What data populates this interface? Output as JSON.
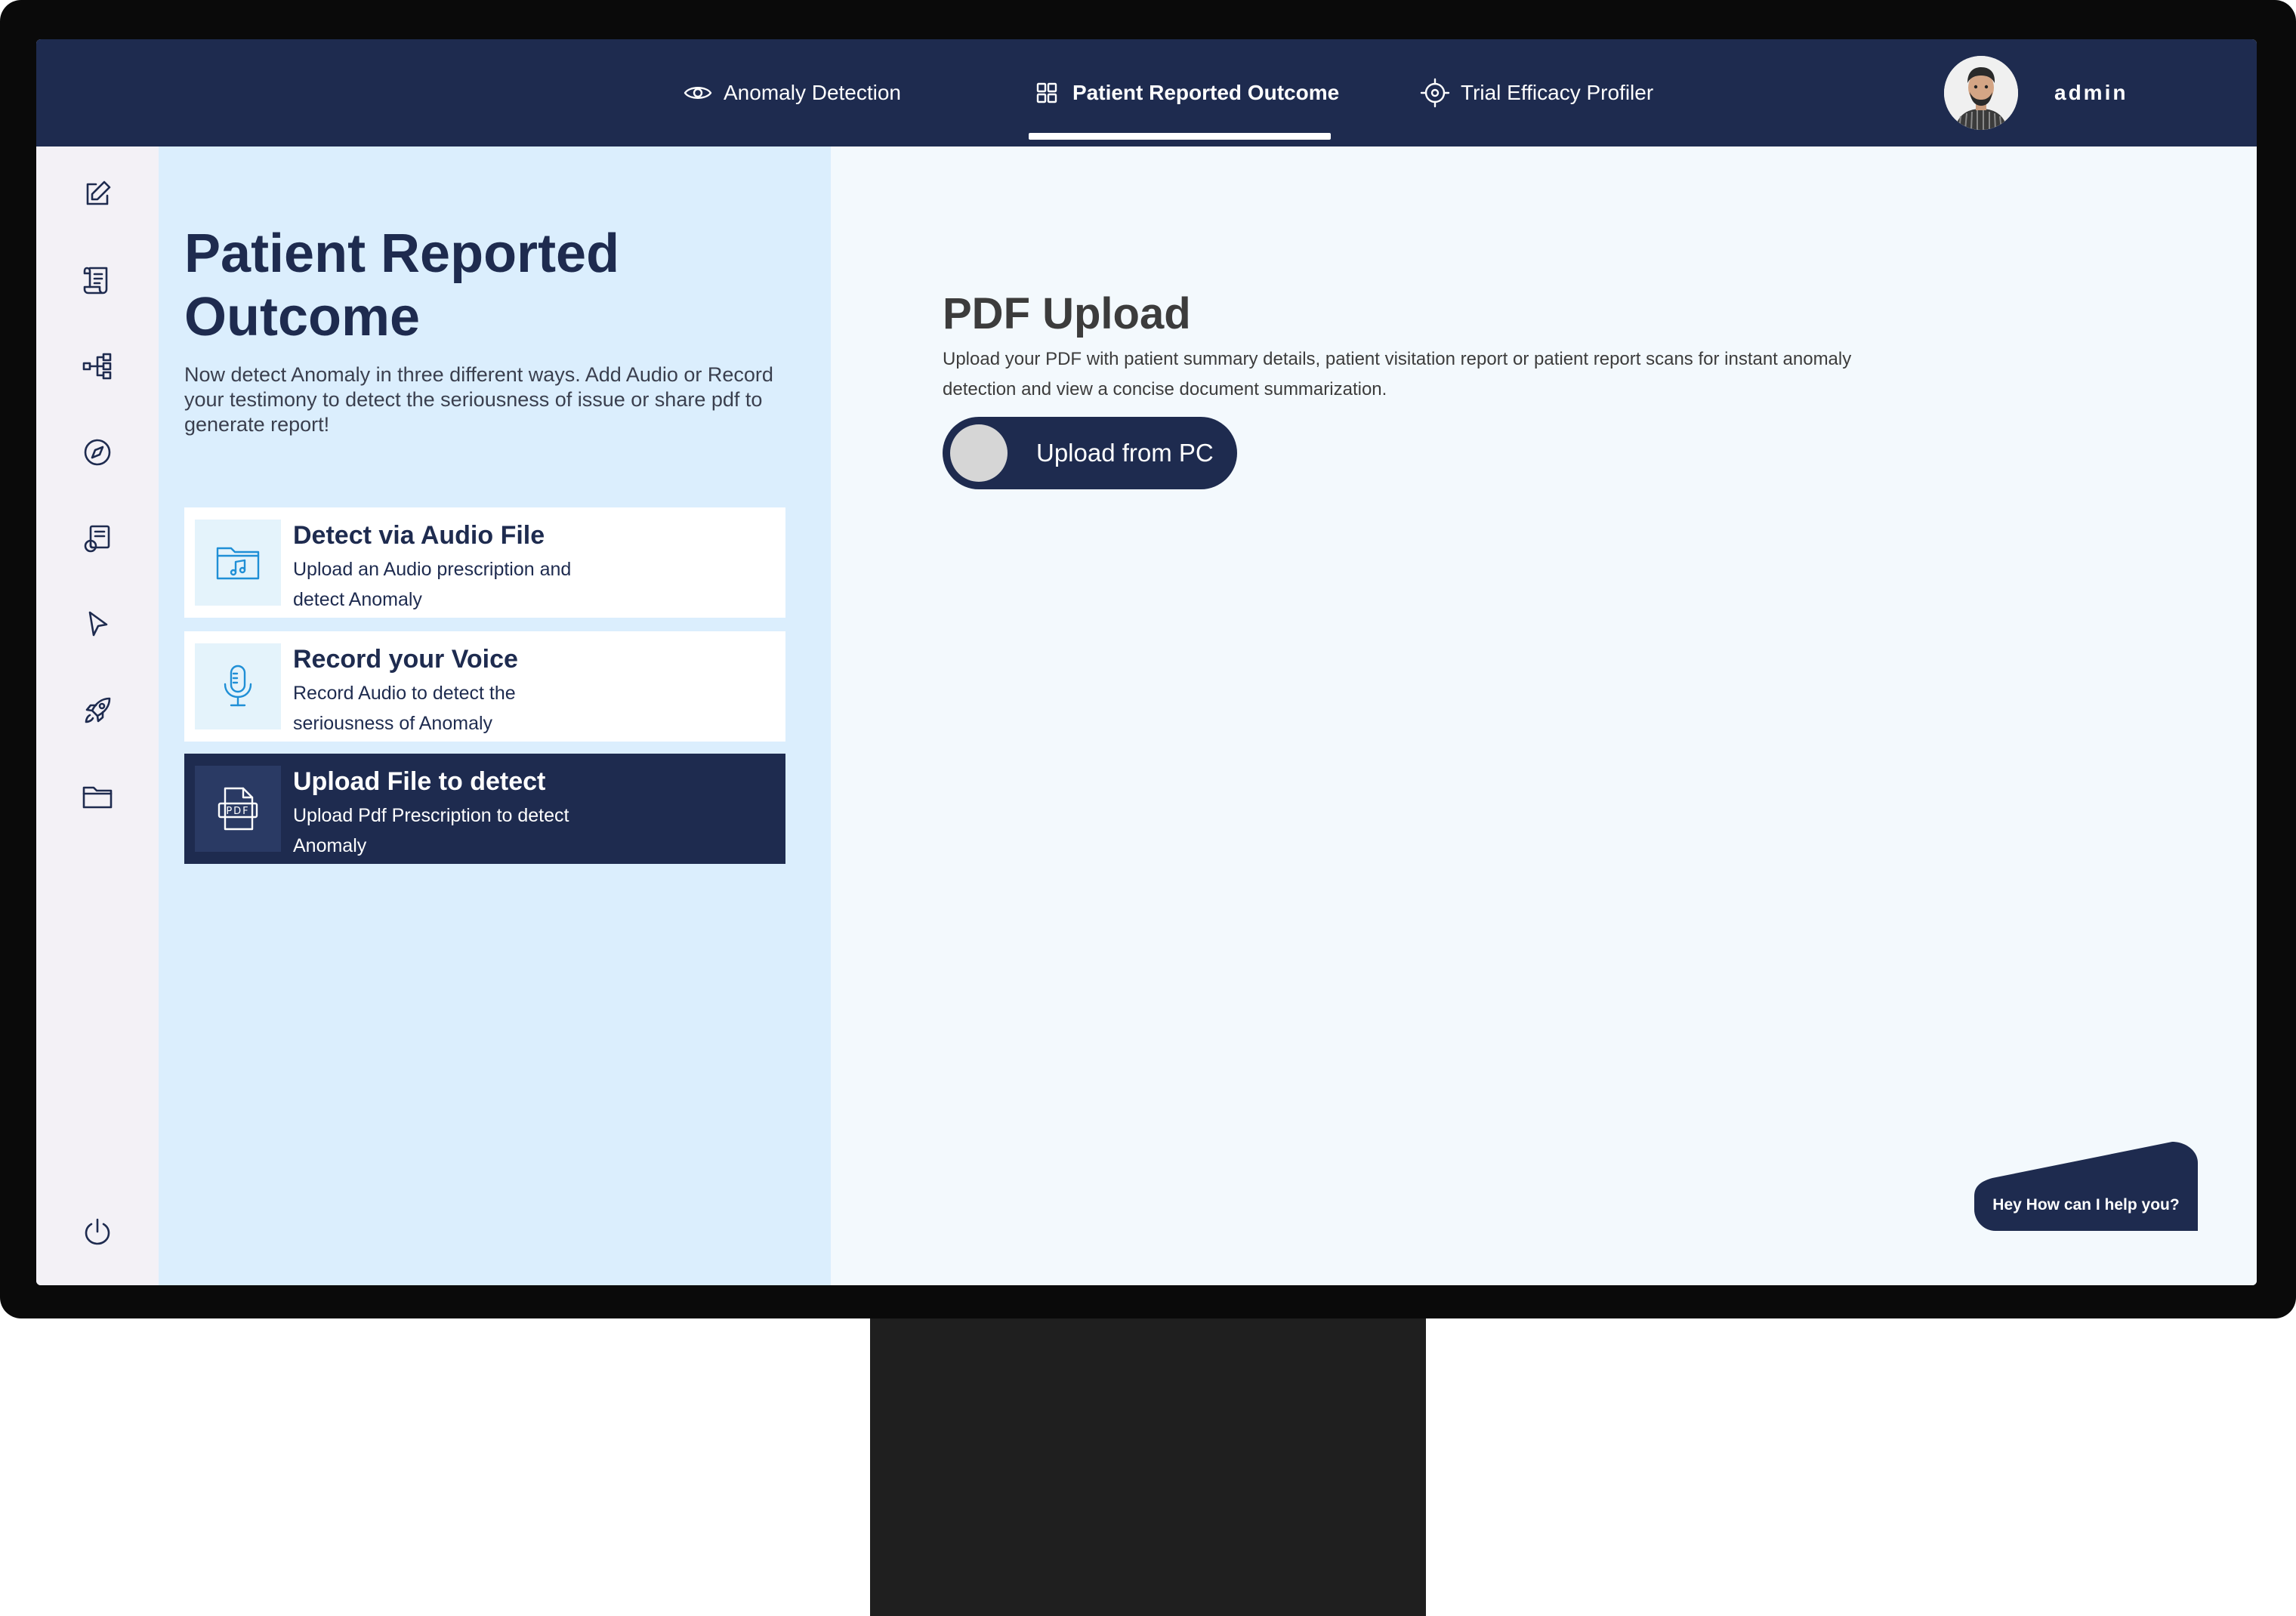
{
  "topnav": {
    "tabs": [
      {
        "label": "Anomaly Detection",
        "icon": "eye-icon"
      },
      {
        "label": "Patient Reported Outcome",
        "icon": "grid-icon",
        "active": true
      },
      {
        "label": "Trial Efficacy Profiler",
        "icon": "crosshair-icon"
      }
    ],
    "user": {
      "name": "admin",
      "avatar": "avatar"
    }
  },
  "sidebar": {
    "items": [
      {
        "icon": "edit-icon"
      },
      {
        "icon": "scroll-icon"
      },
      {
        "icon": "hierarchy-icon"
      },
      {
        "icon": "compass-icon"
      },
      {
        "icon": "document-settings-icon"
      },
      {
        "icon": "cursor-icon"
      },
      {
        "icon": "rocket-icon"
      },
      {
        "icon": "folder-icon"
      }
    ],
    "bottom": {
      "icon": "power-icon"
    }
  },
  "left": {
    "title": "Patient Reported Outcome",
    "description": "Now detect Anomaly in three different ways. Add Audio or Record your testimony to detect the seriousness of issue or share pdf to generate report!",
    "cards": [
      {
        "title": "Detect via Audio File",
        "subtitle": "Upload an Audio prescription and detect Anomaly",
        "icon": "audio-folder-icon"
      },
      {
        "title": "Record your Voice",
        "subtitle": "Record Audio to detect the seriousness of Anomaly",
        "icon": "microphone-icon"
      },
      {
        "title": "Upload File to detect",
        "subtitle": "Upload Pdf Prescription to detect Anomaly",
        "icon": "pdf-icon",
        "selected": true
      }
    ]
  },
  "main": {
    "title": "PDF Upload",
    "description": "Upload your PDF with patient summary details, patient visitation report or patient report scans for instant anomaly detection and view a concise document summarization.",
    "upload_label": "Upload from PC"
  },
  "chat": {
    "label": "Hey How can I help you?"
  },
  "colors": {
    "navy": "#1e2b4f",
    "left_panel": "#dbeefd",
    "main_bg": "#f3f9fd",
    "sidebar_bg": "#f3f1f6",
    "icon_accent": "#1f8fd6"
  }
}
